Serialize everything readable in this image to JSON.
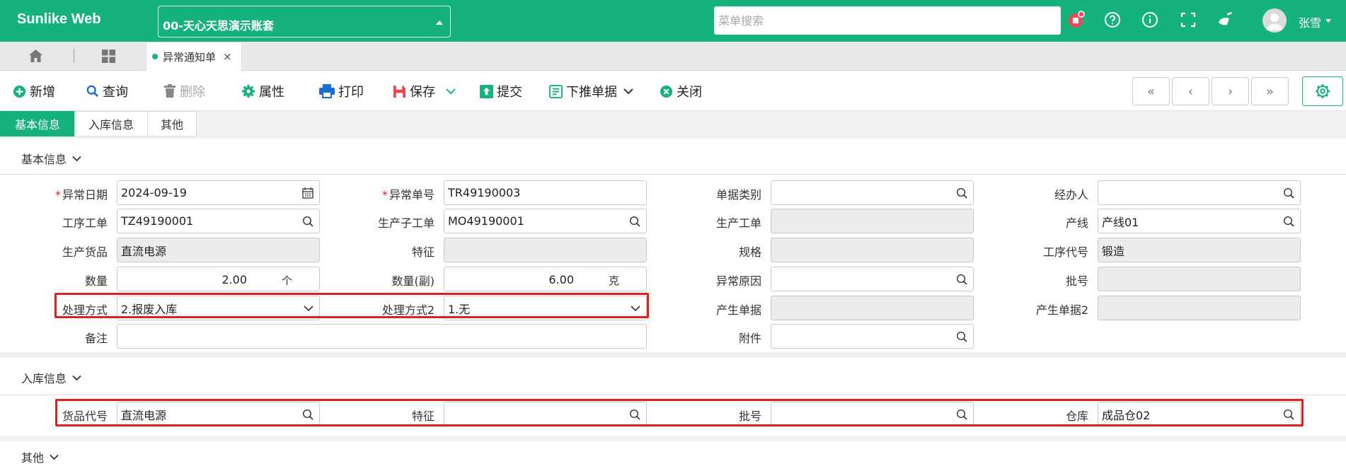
{
  "app": {
    "brand": "Sunlike Web",
    "account": "00-天心天思演示账套",
    "search_placeholder": "菜单搜索",
    "username": "张雪",
    "accent": "#16b27e"
  },
  "tabs": {
    "current_doc": "异常通知单",
    "close_glyph": "×"
  },
  "toolbar": {
    "new": "新增",
    "query": "查询",
    "delete": "删除",
    "properties": "属性",
    "print": "打印",
    "save": "保存",
    "submit": "提交",
    "push_down": "下推单据",
    "close": "关闭",
    "first": "«",
    "prev": "‹",
    "next": "›",
    "last": "»"
  },
  "section_tabs": [
    "基本信息",
    "入库信息",
    "其他"
  ],
  "basic": {
    "title": "基本信息",
    "labels": {
      "exc_date": "异常日期",
      "exc_no": "异常单号",
      "doc_type": "单据类别",
      "handler": "经办人",
      "proc_order": "工序工单",
      "sub_order": "生产子工单",
      "prod_order": "生产工单",
      "line": "产线",
      "product": "生产货品",
      "feature": "特征",
      "spec": "规格",
      "proc_code": "工序代号",
      "qty": "数量",
      "qty2": "数量(副)",
      "reason": "异常原因",
      "batch": "批号",
      "method": "处理方式",
      "method2": "处理方式2",
      "src_doc": "产生单据",
      "src_doc2": "产生单据2",
      "remark": "备注",
      "attach": "附件"
    },
    "values": {
      "exc_date": "2024-09-19",
      "exc_no": "TR49190003",
      "doc_type": "",
      "handler": "",
      "proc_order": "TZ49190001",
      "sub_order": "MO49190001",
      "prod_order": "",
      "line": "产线01",
      "product": "直流电源",
      "feature": "",
      "spec": "",
      "proc_code": "锻造",
      "qty": "2.00",
      "qty_unit": "个",
      "qty2": "6.00",
      "qty2_unit": "克",
      "reason": "",
      "batch": "",
      "method": "2.报废入库",
      "method2": "1.无",
      "src_doc": "",
      "src_doc2": "",
      "remark": "",
      "attach": ""
    }
  },
  "warehouse": {
    "title": "入库信息",
    "labels": {
      "item_code": "货品代号",
      "feature": "特征",
      "batch": "批号",
      "warehouse": "仓库"
    },
    "values": {
      "item_code": "直流电源",
      "feature": "",
      "batch": "",
      "warehouse": "成品仓02"
    }
  },
  "other": {
    "title": "其他"
  }
}
